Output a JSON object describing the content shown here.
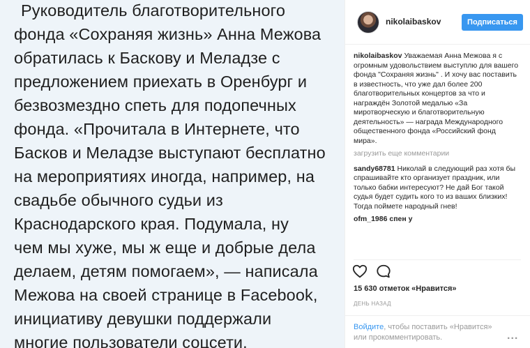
{
  "post_image": {
    "lines": [
      "Руководитель благотворительного",
      "фонда «Сохраняя жизнь» Анна Межова",
      "обратилась к Баскову и Меладзе с",
      "предложением приехать в Оренбург и",
      "безвозмездно спеть для подопечных",
      "фонда. «Прочитала в Интернете, что",
      "Басков и Меладзе выступают бесплатно",
      "на мероприятиях иногда, например, на",
      "свадьбе обычного судьи из",
      "Краснодарского края. Подумала, ну",
      "чем мы хуже, мы ж еще и добрые дела",
      "делаем, детям помогаем», — написала",
      "Межова на своей странице в Facebook,",
      "инициативу девушки поддержали",
      "многие пользователи соцсети."
    ]
  },
  "header": {
    "username": "nikolaibaskov",
    "follow_label": "Подписаться"
  },
  "comments": {
    "caption_author": "nikolaibaskov",
    "caption_text": "Уважаемая Анна Межова я с огромным удовольствием выступлю для вашего фонда \"Сохраняя жизнь\" . И хочу вас поставить в известность, что уже дал более 200 благотворительных концертов за что и награждён Золотой медалью «За миротворческую и благотворительную деятельность» — награда Международного общественного фонда «Российский фонд мира».",
    "load_more": "загрузить еще комментарии",
    "items": [
      {
        "author": "sandy68781",
        "text": "Николай в следующий раз хотя бы спрашивайте кто организует праздник, или только бабки интересуют? Не дай Бог такой судья будет судить кого то из ваших близких! Тогда поймете народный гнев!"
      }
    ],
    "cut_text": "ofm_1986 спен у"
  },
  "actions": {
    "like_icon": "heart-icon",
    "comment_icon": "comment-icon"
  },
  "likes": "15 630 отметок «Нравится»",
  "timestamp": "ДЕНЬ НАЗАД",
  "login": {
    "link": "Войдите",
    "rest": ", чтобы поставить «Нравится» или прокомментировать."
  },
  "more_icon": "more-icon",
  "more_label": "..."
}
